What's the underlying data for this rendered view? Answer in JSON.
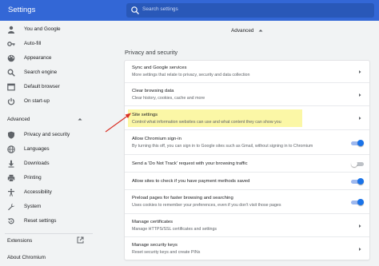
{
  "header": {
    "title": "Settings",
    "search_placeholder": "Search settings"
  },
  "sidebar": {
    "items": [
      {
        "label": "You and Google",
        "icon": "person-icon"
      },
      {
        "label": "Auto-fill",
        "icon": "key-icon"
      },
      {
        "label": "Appearance",
        "icon": "palette-icon"
      },
      {
        "label": "Search engine",
        "icon": "search-icon"
      },
      {
        "label": "Default browser",
        "icon": "browser-icon"
      },
      {
        "label": "On start-up",
        "icon": "power-icon"
      }
    ],
    "advanced_label": "Advanced",
    "advanced_items": [
      {
        "label": "Privacy and security",
        "icon": "shield-icon"
      },
      {
        "label": "Languages",
        "icon": "globe-icon"
      },
      {
        "label": "Downloads",
        "icon": "download-icon"
      },
      {
        "label": "Printing",
        "icon": "printer-icon"
      },
      {
        "label": "Accessibility",
        "icon": "accessibility-icon"
      },
      {
        "label": "System",
        "icon": "wrench-icon"
      },
      {
        "label": "Reset settings",
        "icon": "reset-icon"
      }
    ],
    "extensions_label": "Extensions",
    "about_label": "About Chromium"
  },
  "main": {
    "advanced_label": "Advanced",
    "section_title": "Privacy and security",
    "rows": [
      {
        "title": "Sync and Google services",
        "subtitle": "More settings that relate to privacy, security and data collection",
        "control": "arrow"
      },
      {
        "title": "Clear browsing data",
        "subtitle": "Clear history, cookies, cache and more",
        "control": "arrow"
      },
      {
        "title": "Site settings",
        "subtitle": "Control what information websites can use and what content they can show you",
        "control": "arrow",
        "highlighted": true
      },
      {
        "title": "Allow Chromium sign-in",
        "subtitle": "By turning this off, you can sign in to Google sites such as Gmail, without signing in to Chromium",
        "control": "toggle",
        "on": true
      },
      {
        "title": "Send a 'Do Not Track' request with your browsing traffic",
        "subtitle": "",
        "control": "toggle",
        "on": false
      },
      {
        "title": "Allow sites to check if you have payment methods saved",
        "subtitle": "",
        "control": "toggle",
        "on": true
      },
      {
        "title": "Preload pages for faster browsing and searching",
        "subtitle": "Uses cookies to remember your preferences, even if you don't visit those pages",
        "control": "toggle",
        "on": true
      },
      {
        "title": "Manage certificates",
        "subtitle": "Manage HTTPS/SSL certificates and settings",
        "control": "arrow"
      },
      {
        "title": "Manage security keys",
        "subtitle": "Reset security keys and create PINs",
        "control": "arrow"
      }
    ]
  },
  "colors": {
    "header": "#3367d6",
    "accent": "#1a73e8",
    "highlight": "#fbf7a6",
    "annotation_arrow": "#d93025"
  }
}
